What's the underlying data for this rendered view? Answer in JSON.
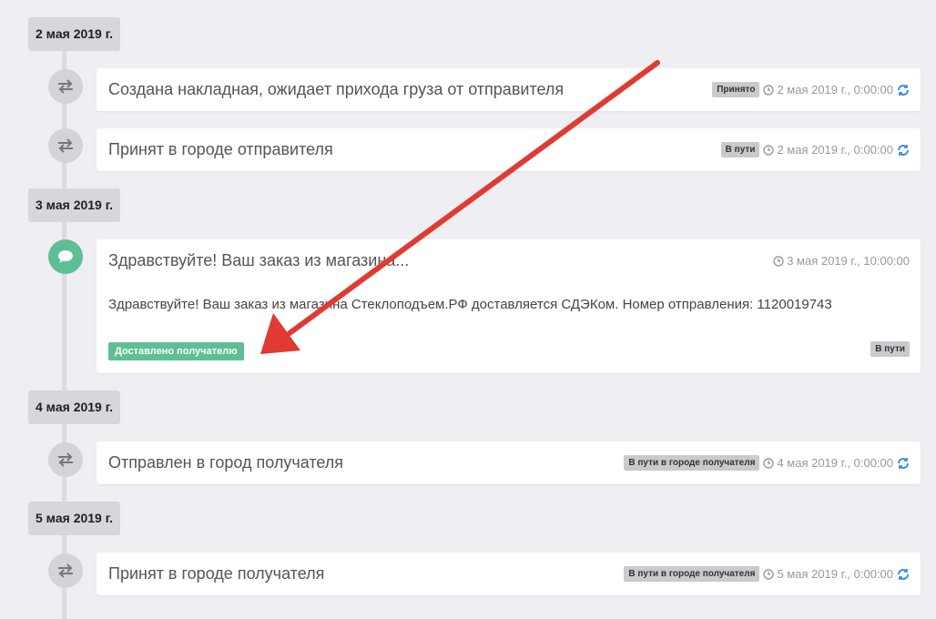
{
  "colors": {
    "page_bg": "#eeeef3",
    "badge_gray": "#c9c9ce",
    "badge_green": "#5dbf93",
    "arrow_red": "#e03a32"
  },
  "dates": [
    "2 мая 2019 г.",
    "3 мая 2019 г.",
    "4 мая 2019 г.",
    "5 мая 2019 г."
  ],
  "events": [
    {
      "title": "Создана накладная, ожидает прихода груза от отправителя",
      "badge": "Принято",
      "time": "2 мая 2019 г., 0:00:00",
      "icon": "exchange-icon"
    },
    {
      "title": "Принят в городе отправителя",
      "badge": "В пути",
      "time": "2 мая 2019 г., 0:00:00",
      "icon": "exchange-icon"
    },
    {
      "title": "Здравствуйте! Ваш заказ из магазина...",
      "body": "Здравствуйте! Ваш заказ из магазина Стеклоподъем.РФ доставляется СДЭКом. Номер отправления: 1120019743",
      "tag": "Доставлено получателю",
      "badge": "В пути",
      "time": "3 мая 2019 г., 10:00:00",
      "icon": "comment-icon"
    },
    {
      "title": "Отправлен в город получателя",
      "badge": "В пути в городе получателя",
      "time": "4 мая 2019 г., 0:00:00",
      "icon": "exchange-icon"
    },
    {
      "title": "Принят в городе получателя",
      "badge": "В пути в городе получателя",
      "time": "5 мая 2019 г., 0:00:00",
      "icon": "exchange-icon"
    }
  ]
}
